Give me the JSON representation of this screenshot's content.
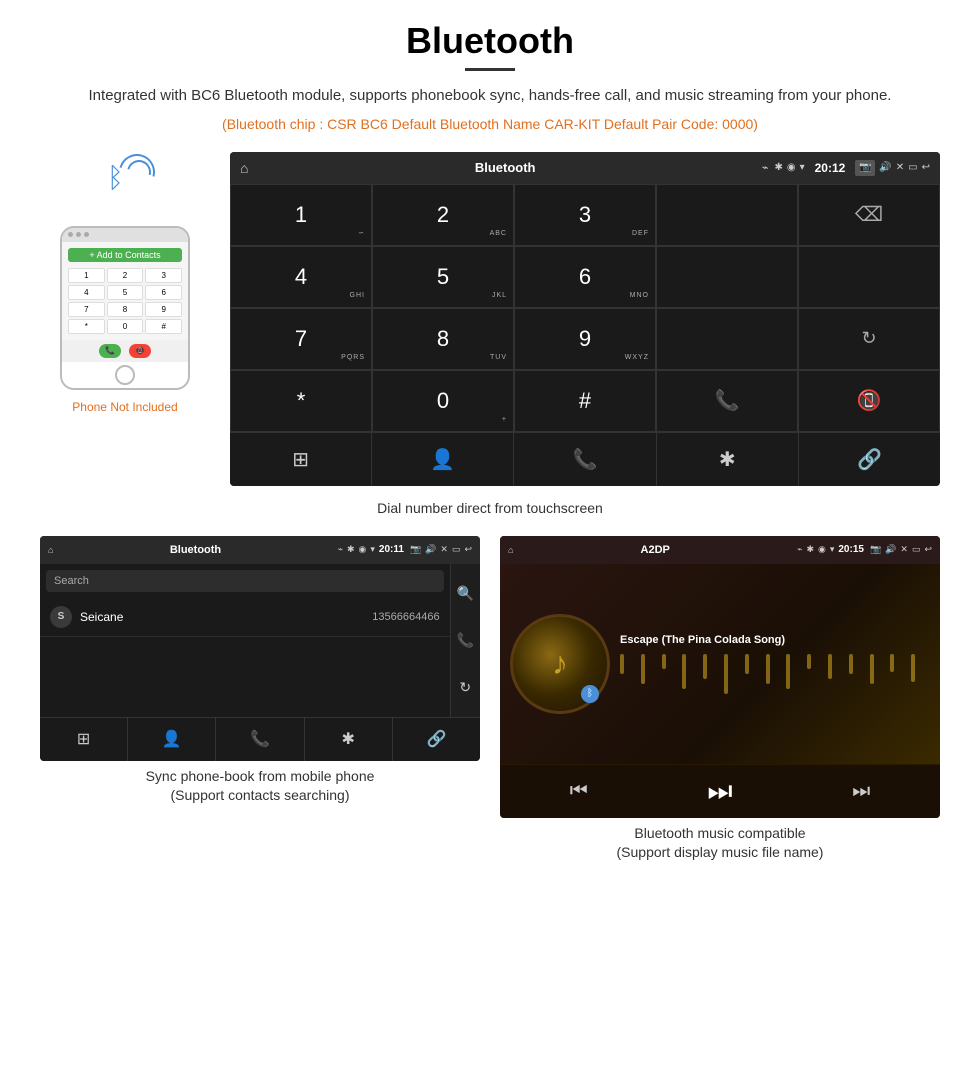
{
  "header": {
    "title": "Bluetooth",
    "description": "Integrated with BC6 Bluetooth module, supports phonebook sync, hands-free call, and music streaming from your phone.",
    "specs": "(Bluetooth chip : CSR BC6    Default Bluetooth Name CAR-KIT    Default Pair Code: 0000)"
  },
  "main_screen": {
    "status_bar": {
      "title": "Bluetooth",
      "usb_symbol": "⌁",
      "time": "20:12"
    },
    "dialpad": {
      "keys": [
        {
          "num": "1",
          "sub": "∽"
        },
        {
          "num": "2",
          "sub": "ABC"
        },
        {
          "num": "3",
          "sub": "DEF"
        },
        {
          "num": "",
          "sub": ""
        },
        {
          "num": "⌫",
          "sub": ""
        },
        {
          "num": "4",
          "sub": "GHI"
        },
        {
          "num": "5",
          "sub": "JKL"
        },
        {
          "num": "6",
          "sub": "MNO"
        },
        {
          "num": "",
          "sub": ""
        },
        {
          "num": "",
          "sub": ""
        },
        {
          "num": "7",
          "sub": "PQRS"
        },
        {
          "num": "8",
          "sub": "TUV"
        },
        {
          "num": "9",
          "sub": "WXYZ"
        },
        {
          "num": "",
          "sub": ""
        },
        {
          "num": "↺",
          "sub": ""
        },
        {
          "num": "*",
          "sub": ""
        },
        {
          "num": "0",
          "sub": "+"
        },
        {
          "num": "#",
          "sub": ""
        },
        {
          "num": "📞",
          "sub": ""
        },
        {
          "num": "📵",
          "sub": ""
        }
      ]
    },
    "bottom_icons": [
      "⊞",
      "👤",
      "📞",
      "✱",
      "🔗"
    ]
  },
  "main_caption": "Dial number direct from touchscreen",
  "phone_illustration": {
    "not_included": "Phone Not Included"
  },
  "phonebook_screen": {
    "status_bar": {
      "title": "Bluetooth",
      "time": "20:11"
    },
    "search_placeholder": "Search",
    "contact": {
      "letter": "S",
      "name": "Seicane",
      "phone": "13566664466"
    },
    "side_icons": [
      "🔍",
      "📞",
      "↺"
    ]
  },
  "music_screen": {
    "status_bar": {
      "title": "A2DP",
      "time": "20:15"
    },
    "song_title": "Escape (The Pina Colada Song)",
    "controls": [
      "⏮",
      "⏭",
      "⏭"
    ]
  },
  "captions": {
    "phonebook": "Sync phone-book from mobile phone\n(Support contacts searching)",
    "music": "Bluetooth music compatible\n(Support display music file name)"
  }
}
